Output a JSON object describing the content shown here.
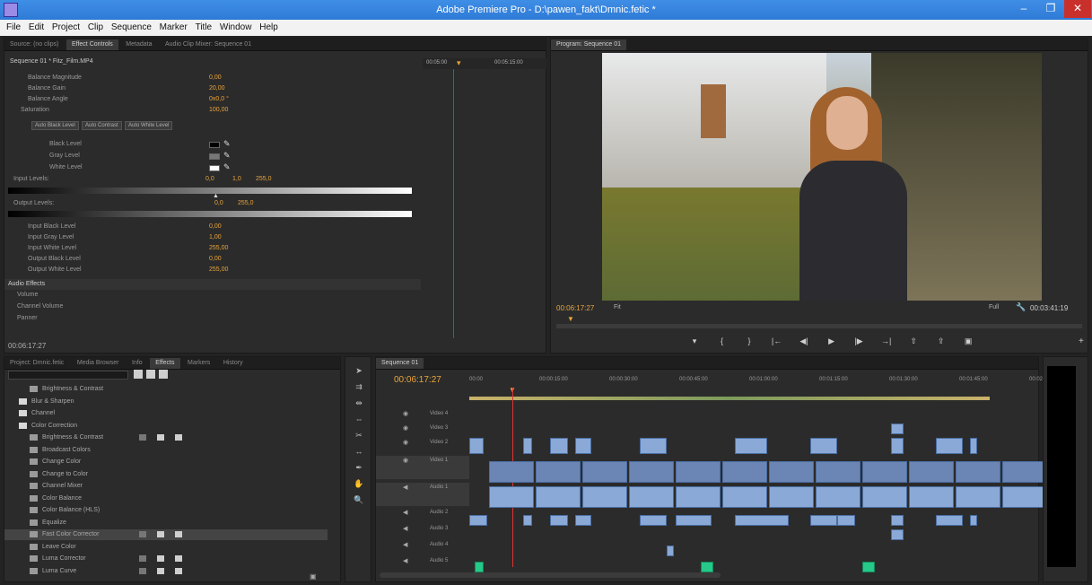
{
  "window": {
    "title": "Adobe Premiere Pro - D:\\pawen_fakt\\Dmnic.fetic *",
    "min": "–",
    "max": "❐",
    "close": "✕"
  },
  "menu": [
    "File",
    "Edit",
    "Project",
    "Clip",
    "Sequence",
    "Marker",
    "Title",
    "Window",
    "Help"
  ],
  "source_panel": {
    "tabs": [
      "Source: (no clips)",
      "Effect Controls",
      "Metadata",
      "Audio Clip Mixer: Sequence 01"
    ],
    "header": "Sequence 01 * Fitz_Film.MP4",
    "time_start": "00:05:00",
    "time_end": "00:05:15:00",
    "params": [
      {
        "label": "Balance Magnitude",
        "value": "0,00"
      },
      {
        "label": "Balance Gain",
        "value": "20,00"
      },
      {
        "label": "Balance Angle",
        "value": "0x0,0 °"
      },
      {
        "label": "Saturation",
        "value": "100,00"
      }
    ],
    "buttons": [
      "Auto Black Level",
      "Auto Contrast",
      "Auto White Level"
    ],
    "levels": [
      {
        "label": "Black Level"
      },
      {
        "label": "Gray Level"
      },
      {
        "label": "White Level"
      }
    ],
    "input_levels_label": "Input Levels:",
    "input_levels": [
      "0,0",
      "1,0",
      "255,0"
    ],
    "output_levels_label": "Output Levels:",
    "output_levels": [
      "0,0",
      "255,0"
    ],
    "params2": [
      {
        "label": "Input Black Level",
        "value": "0,00"
      },
      {
        "label": "Input Gray Level",
        "value": "1,00"
      },
      {
        "label": "Input White Level",
        "value": "255,00"
      },
      {
        "label": "Output Black Level",
        "value": "0,00"
      },
      {
        "label": "Output White Level",
        "value": "255,00"
      }
    ],
    "audio_header": "Audio Effects",
    "audio_items": [
      "Volume",
      "Channel Volume",
      "Panner"
    ],
    "timecode": "00:06:17:27"
  },
  "program_panel": {
    "tab": "Program: Sequence 01",
    "timecode": "00:06:17:27",
    "fit": "Fit",
    "quality": "Full",
    "duration": "00:03:41:19"
  },
  "effects_panel": {
    "tabs": [
      "Project: Dmnic.fetic",
      "Media Browser",
      "Info",
      "Effects",
      "Markers",
      "History"
    ],
    "items": [
      {
        "label": "Brightness & Contrast",
        "indent": 2,
        "icons": false
      },
      {
        "label": "Blur & Sharpen",
        "indent": 1,
        "folder": true
      },
      {
        "label": "Channel",
        "indent": 1,
        "folder": true
      },
      {
        "label": "Color Correction",
        "indent": 1,
        "folder": true,
        "open": true
      },
      {
        "label": "Brightness & Contrast",
        "indent": 2,
        "icons": true
      },
      {
        "label": "Broadcast Colors",
        "indent": 2
      },
      {
        "label": "Change Color",
        "indent": 2
      },
      {
        "label": "Change to Color",
        "indent": 2
      },
      {
        "label": "Channel Mixer",
        "indent": 2
      },
      {
        "label": "Color Balance",
        "indent": 2
      },
      {
        "label": "Color Balance (HLS)",
        "indent": 2
      },
      {
        "label": "Equalize",
        "indent": 2
      },
      {
        "label": "Fast Color Corrector",
        "indent": 2,
        "icons": true,
        "selected": true
      },
      {
        "label": "Leave Color",
        "indent": 2
      },
      {
        "label": "Luma Corrector",
        "indent": 2,
        "icons": true
      },
      {
        "label": "Luma Curve",
        "indent": 2,
        "icons": true
      }
    ]
  },
  "timeline": {
    "tab": "Sequence 01",
    "timecode": "00:06:17:27",
    "ruler": [
      "00:00",
      "00:00:15:00",
      "00:00:30:00",
      "00:00:45:00",
      "00:01:00:00",
      "00:01:15:00",
      "00:01:30:00",
      "00:01:45:00",
      "00:02:00:00"
    ],
    "tracks": [
      "Video 4",
      "Video 3",
      "Video 2",
      "Video 1",
      "Audio 1",
      "Audio 2",
      "Audio 3",
      "Audio 4",
      "Audio 5"
    ],
    "v1_label": "V1",
    "a1_label": "A1"
  }
}
